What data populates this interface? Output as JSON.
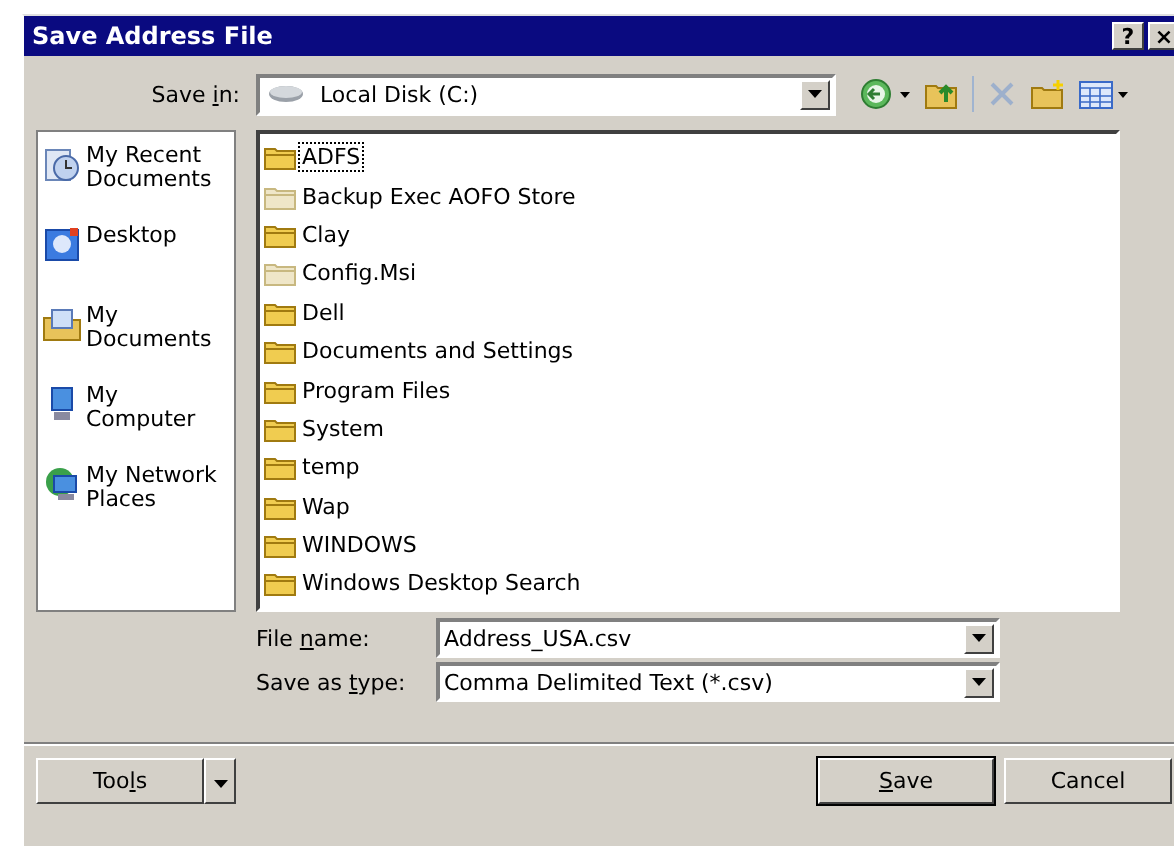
{
  "window": {
    "title": "Save Address File",
    "title_buttons": [
      "?",
      "×"
    ]
  },
  "save_in": {
    "label_parts": [
      "Save ",
      "i",
      "n:"
    ],
    "value": "Local Disk (C:)"
  },
  "places": [
    {
      "label": "My Recent Documents",
      "kind": "recent"
    },
    {
      "label": "Desktop",
      "kind": "desktop"
    },
    {
      "label": "My Documents",
      "kind": "documents"
    },
    {
      "label": "My Computer",
      "kind": "computer"
    },
    {
      "label": "My Network Places",
      "kind": "network"
    }
  ],
  "files": [
    {
      "name": "ADFS",
      "hidden": false,
      "focused": true
    },
    {
      "name": "Backup Exec AOFO Store",
      "hidden": true,
      "focused": false
    },
    {
      "name": "Clay",
      "hidden": false,
      "focused": false
    },
    {
      "name": "Config.Msi",
      "hidden": true,
      "focused": false
    },
    {
      "name": "Dell",
      "hidden": false,
      "focused": false
    },
    {
      "name": "Documents and Settings",
      "hidden": false,
      "focused": false
    },
    {
      "name": "Program Files",
      "hidden": false,
      "focused": false
    },
    {
      "name": "System",
      "hidden": false,
      "focused": false
    },
    {
      "name": "temp",
      "hidden": false,
      "focused": false
    },
    {
      "name": "Wap",
      "hidden": false,
      "focused": false
    },
    {
      "name": "WINDOWS",
      "hidden": false,
      "focused": false
    },
    {
      "name": "Windows Desktop Search",
      "hidden": false,
      "focused": false
    }
  ],
  "file_name": {
    "label_parts": [
      "File ",
      "n",
      "ame:"
    ],
    "value": "Address_USA.csv"
  },
  "save_as_type": {
    "label_parts": [
      "Save as ",
      "t",
      "ype:"
    ],
    "value": "Comma Delimited Text (*.csv)"
  },
  "buttons": {
    "tools": {
      "before": "Too",
      "key": "l",
      "after": "s"
    },
    "save": {
      "key": "S",
      "after": "ave"
    },
    "cancel": {
      "before": "Cancel"
    }
  }
}
